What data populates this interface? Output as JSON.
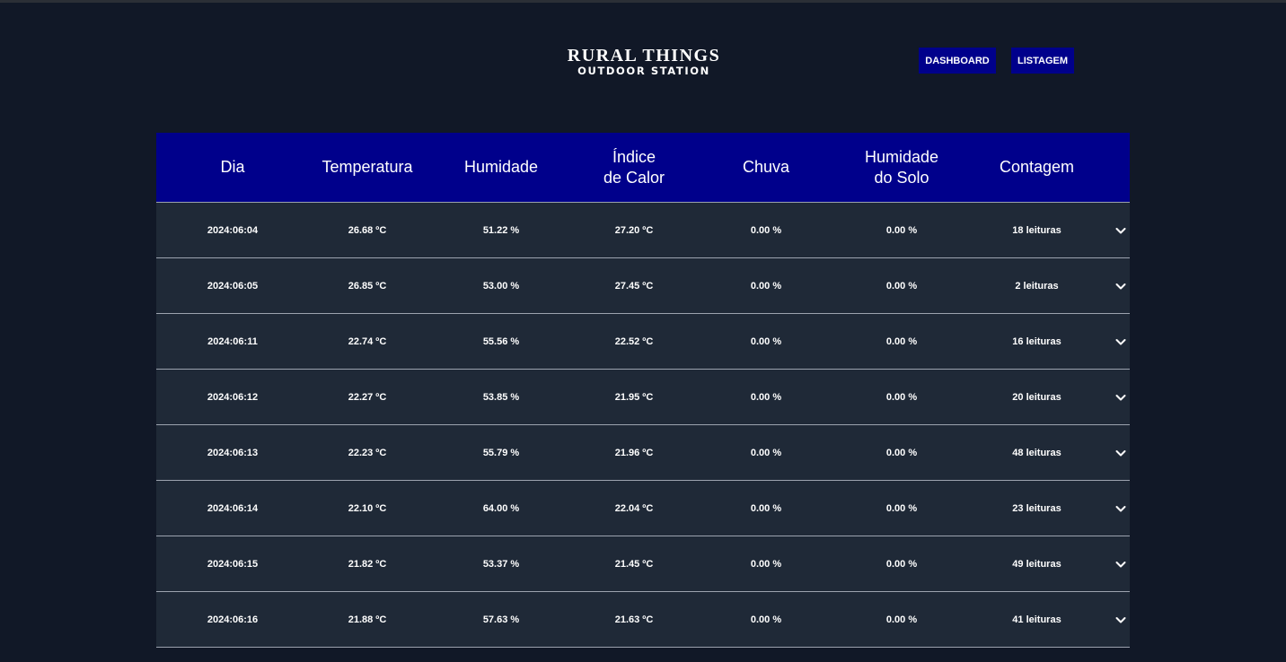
{
  "brand": {
    "title": "RURAL THINGS",
    "subtitle": "OUTDOOR STATION"
  },
  "nav": {
    "dashboard": "DASHBOARD",
    "listagem": "LISTAGEM"
  },
  "table": {
    "headers": {
      "dia": "Dia",
      "temperatura": "Temperatura",
      "humidade": "Humidade",
      "indice_line1": "Índice",
      "indice_line2": "de Calor",
      "chuva": "Chuva",
      "solo_line1": "Humidade",
      "solo_line2": "do Solo",
      "contagem": "Contagem"
    },
    "rows": [
      {
        "dia": "2024:06:04",
        "temp": "26.68 ºC",
        "hum": "51.22 %",
        "calor": "27.20 ºC",
        "chuva": "0.00 %",
        "solo": "0.00 %",
        "contagem": "18 leituras"
      },
      {
        "dia": "2024:06:05",
        "temp": "26.85 ºC",
        "hum": "53.00 %",
        "calor": "27.45 ºC",
        "chuva": "0.00 %",
        "solo": "0.00 %",
        "contagem": "2 leituras"
      },
      {
        "dia": "2024:06:11",
        "temp": "22.74 ºC",
        "hum": "55.56 %",
        "calor": "22.52 ºC",
        "chuva": "0.00 %",
        "solo": "0.00 %",
        "contagem": "16 leituras"
      },
      {
        "dia": "2024:06:12",
        "temp": "22.27 ºC",
        "hum": "53.85 %",
        "calor": "21.95 ºC",
        "chuva": "0.00 %",
        "solo": "0.00 %",
        "contagem": "20 leituras"
      },
      {
        "dia": "2024:06:13",
        "temp": "22.23 ºC",
        "hum": "55.79 %",
        "calor": "21.96 ºC",
        "chuva": "0.00 %",
        "solo": "0.00 %",
        "contagem": "48 leituras"
      },
      {
        "dia": "2024:06:14",
        "temp": "22.10 ºC",
        "hum": "64.00 %",
        "calor": "22.04 ºC",
        "chuva": "0.00 %",
        "solo": "0.00 %",
        "contagem": "23 leituras"
      },
      {
        "dia": "2024:06:15",
        "temp": "21.82 ºC",
        "hum": "53.37 %",
        "calor": "21.45 ºC",
        "chuva": "0.00 %",
        "solo": "0.00 %",
        "contagem": "49 leituras"
      },
      {
        "dia": "2024:06:16",
        "temp": "21.88 ºC",
        "hum": "57.63 %",
        "calor": "21.63 ºC",
        "chuva": "0.00 %",
        "solo": "0.00 %",
        "contagem": "41 leituras"
      }
    ]
  },
  "colors": {
    "background": "#111827",
    "header_blue": "#00008b",
    "row_bg": "#1f2937",
    "divider": "#9ca3af"
  },
  "icons": {
    "expand": "chevron-down-icon"
  }
}
